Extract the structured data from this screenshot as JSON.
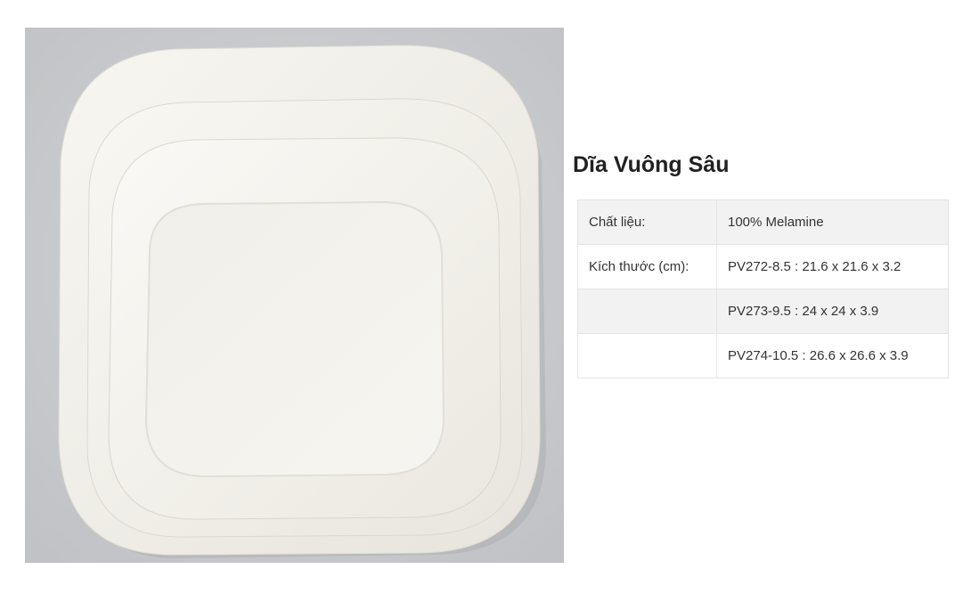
{
  "product": {
    "title": "Dĩa Vuông Sâu",
    "image_name": "square-deep-plates-photo"
  },
  "colors": {
    "background": "#ffffff",
    "photo_backdrop": "#c9cbce",
    "plate": "#f4f2ec",
    "table_border": "#e4e4e4",
    "table_shade": "#f2f2f2",
    "text": "#333333"
  },
  "specs": [
    {
      "label": "Chất liệu:",
      "value": "100% Melamine"
    },
    {
      "label": "Kích thước (cm):",
      "value": "PV272-8.5 : 21.6 x 21.6 x 3.2"
    },
    {
      "label": "",
      "value": "PV273-9.5 : 24 x 24 x 3.9"
    },
    {
      "label": "",
      "value": "PV274-10.5 : 26.6 x 26.6 x 3.9"
    }
  ]
}
